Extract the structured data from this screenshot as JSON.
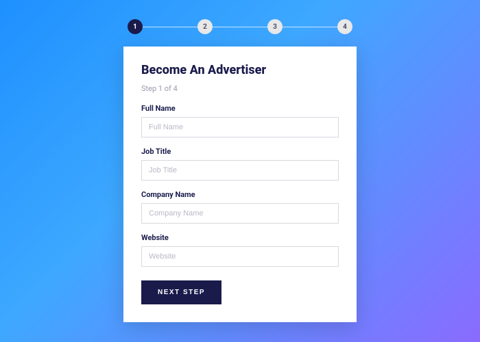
{
  "stepper": {
    "steps": [
      "1",
      "2",
      "3",
      "4"
    ],
    "activeIndex": 0
  },
  "card": {
    "title": "Become An Advertiser",
    "stepText": "Step 1 of 4",
    "fields": [
      {
        "label": "Full Name",
        "placeholder": "Full Name",
        "value": ""
      },
      {
        "label": "Job Title",
        "placeholder": "Job Title",
        "value": ""
      },
      {
        "label": "Company Name",
        "placeholder": "Company Name",
        "value": ""
      },
      {
        "label": "Website",
        "placeholder": "Website",
        "value": ""
      }
    ],
    "nextButton": "NEXT STEP"
  },
  "colors": {
    "accent": "#1a1b4b",
    "bgGradientStart": "#1e90ff",
    "bgGradientEnd": "#8a6bff"
  }
}
